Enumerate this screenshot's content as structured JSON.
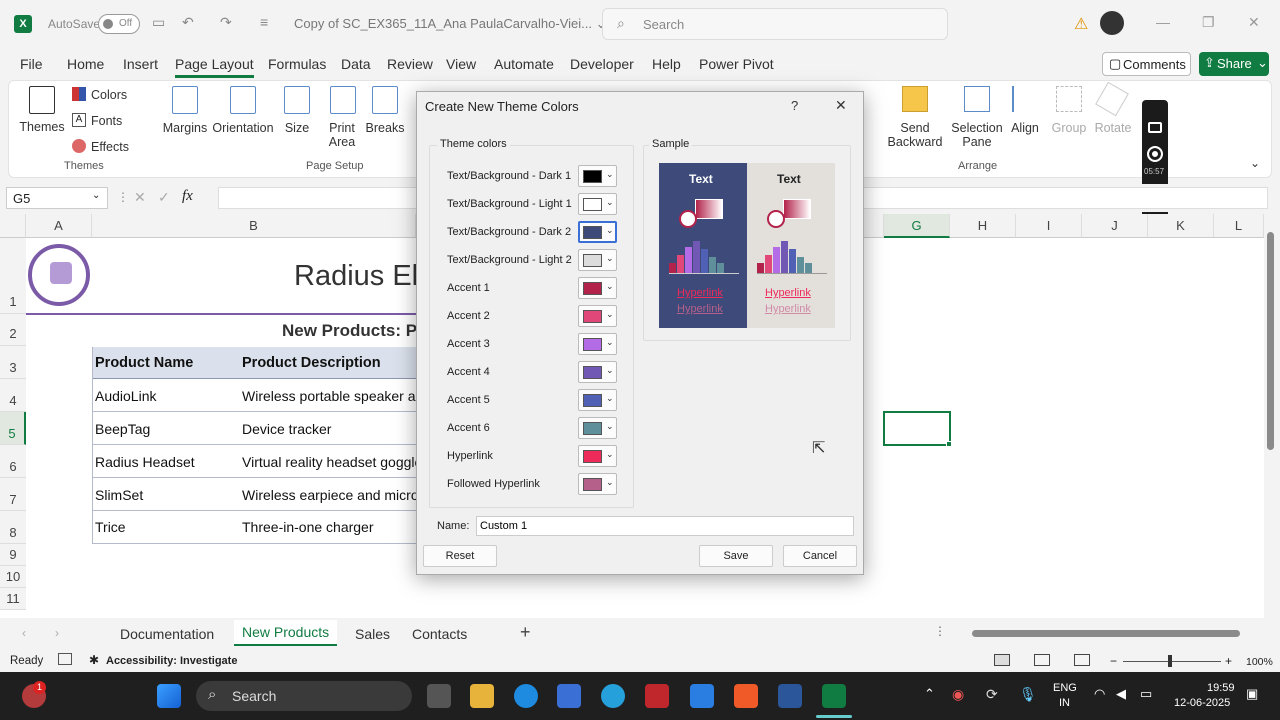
{
  "titlebar": {
    "autosave_label": "AutoSave",
    "autosave_state": "Off",
    "doc_title": "Copy of SC_EX365_11A_Ana PaulaCarvalho-Viei... ⌄",
    "search_placeholder": "Search"
  },
  "menu": {
    "tabs": [
      "File",
      "Home",
      "Insert",
      "Page Layout",
      "Formulas",
      "Data",
      "Review",
      "View",
      "Automate",
      "Developer",
      "Help",
      "Power Pivot"
    ],
    "active": "Page Layout",
    "comments": "Comments",
    "share": "Share"
  },
  "ribbon": {
    "themes": "Themes",
    "colors": "Colors",
    "fonts": "Fonts",
    "effects": "Effects",
    "group_themes": "Themes",
    "margins": "Margins",
    "orientation": "Orientation",
    "size": "Size",
    "print_area": "Print Area",
    "breaks": "Breaks",
    "group_page_setup": "Page Setup",
    "send_backward": "Send Backward",
    "selection_pane": "Selection Pane",
    "align": "Align",
    "group": "Group",
    "rotate": "Rotate",
    "group_arrange": "Arrange"
  },
  "formula": {
    "name_box": "G5",
    "fx": "fx"
  },
  "columns": [
    "A",
    "B",
    "G",
    "H",
    "I",
    "J",
    "K",
    "L"
  ],
  "rows": [
    "1",
    "2",
    "3",
    "4",
    "5",
    "6",
    "7",
    "8",
    "9",
    "10",
    "11"
  ],
  "sheet": {
    "title": "Radius El",
    "subtitle": "New Products: P",
    "headers": [
      "Product Name",
      "Product Description"
    ],
    "products": [
      {
        "name": "AudioLink",
        "desc": "Wireless portable speaker an"
      },
      {
        "name": "BeepTag",
        "desc": "Device tracker"
      },
      {
        "name": "Radius Headset",
        "desc": "Virtual reality headset goggles"
      },
      {
        "name": "SlimSet",
        "desc": "Wireless earpiece and micro"
      },
      {
        "name": "Trice",
        "desc": "Three-in-one charger"
      }
    ]
  },
  "sheet_tabs": [
    "Documentation",
    "New Products",
    "Sales",
    "Contacts"
  ],
  "active_sheet": "New Products",
  "status": {
    "ready": "Ready",
    "accessibility": "Accessibility: Investigate",
    "zoom": "100%"
  },
  "recorder": {
    "time": "05:57"
  },
  "taskbar": {
    "search": "Search",
    "lang1": "ENG",
    "lang2": "IN",
    "time": "19:59",
    "date": "12-06-2025",
    "badge": "1"
  },
  "dialog": {
    "title": "Create New Theme Colors",
    "help": "?",
    "close": "✕",
    "theme_colors_legend": "Theme colors",
    "sample_legend": "Sample",
    "colors": [
      {
        "label": "Text/Background - Dark 1",
        "color": "#000000"
      },
      {
        "label": "Text/Background - Light 1",
        "color": "#ffffff"
      },
      {
        "label": "Text/Background - Dark 2",
        "color": "#3d4a7a"
      },
      {
        "label": "Text/Background - Light 2",
        "color": "#dcdcdc"
      },
      {
        "label": "Accent 1",
        "color": "#b3224a"
      },
      {
        "label": "Accent 2",
        "color": "#e2477a"
      },
      {
        "label": "Accent 3",
        "color": "#b36be6"
      },
      {
        "label": "Accent 4",
        "color": "#7258b5"
      },
      {
        "label": "Accent 5",
        "color": "#5060b5"
      },
      {
        "label": "Accent 6",
        "color": "#5f8f9b"
      },
      {
        "label": "Hyperlink",
        "color": "#ee2a5a"
      },
      {
        "label": "Followed Hyperlink",
        "color": "#b5608a"
      }
    ],
    "selected_index": 2,
    "sample_text": "Text",
    "sample_hyperlink": "Hyperlink",
    "sample_followed": "Hyperlink",
    "name_label": "Name:",
    "name_value": "Custom 1",
    "reset": "Reset",
    "save": "Save",
    "cancel": "Cancel"
  }
}
